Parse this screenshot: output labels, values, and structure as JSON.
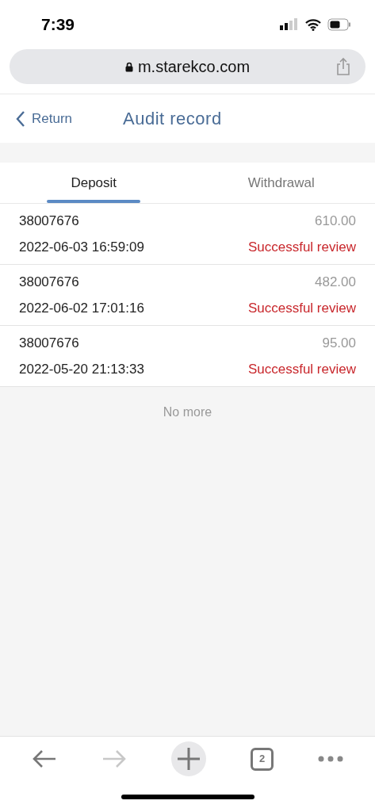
{
  "status_bar": {
    "time": "7:39"
  },
  "browser": {
    "url": "m.starekco.com",
    "tab_count": "2",
    "forward_disabled": true
  },
  "header": {
    "back_label": "Return",
    "title": "Audit record"
  },
  "tabs": [
    {
      "label": "Deposit",
      "selected": true
    },
    {
      "label": "Withdrawal",
      "selected": false
    }
  ],
  "records": [
    {
      "id": "38007676",
      "amount": "610.00",
      "time": "2022-06-03 16:59:09",
      "status": "Successful review"
    },
    {
      "id": "38007676",
      "amount": "482.00",
      "time": "2022-06-02 17:01:16",
      "status": "Successful review"
    },
    {
      "id": "38007676",
      "amount": "95.00",
      "time": "2022-05-20 21:13:33",
      "status": "Successful review"
    }
  ],
  "footer_note": "No more"
}
